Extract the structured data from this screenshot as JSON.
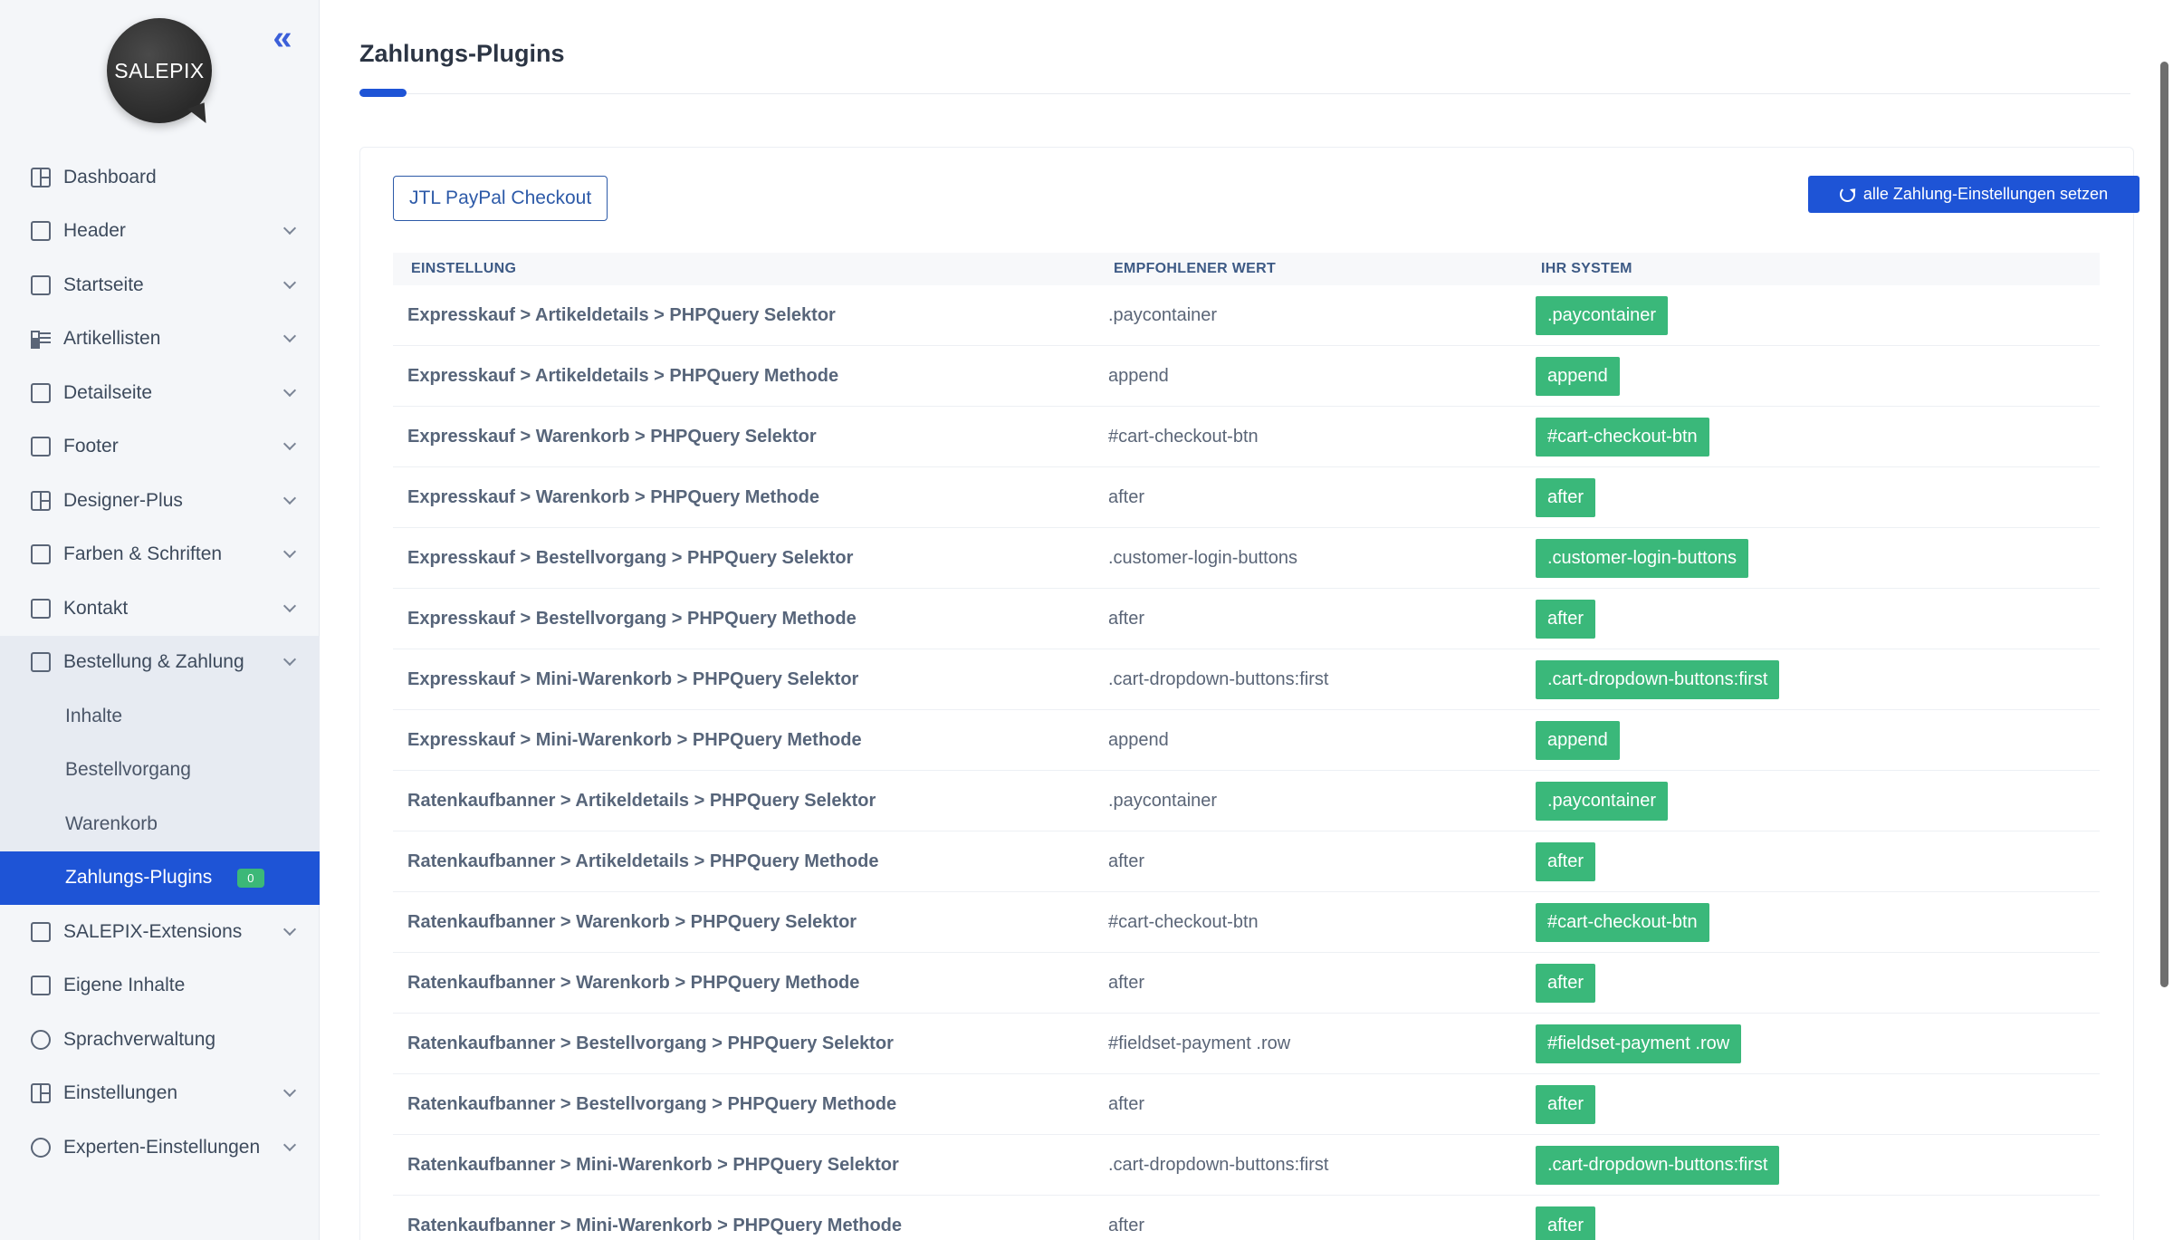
{
  "sidebar": {
    "logo_text": "SALEPIX",
    "collapse_symbol": "«",
    "items": [
      {
        "label": "Dashboard",
        "icon": "dashboard-icon",
        "has_children": false
      },
      {
        "label": "Header",
        "icon": "header-icon",
        "has_children": true
      },
      {
        "label": "Startseite",
        "icon": "home-icon",
        "has_children": true
      },
      {
        "label": "Artikellisten",
        "icon": "list-icon",
        "has_children": true
      },
      {
        "label": "Detailseite",
        "icon": "page-icon",
        "has_children": true
      },
      {
        "label": "Footer",
        "icon": "footer-icon",
        "has_children": true
      },
      {
        "label": "Designer-Plus",
        "icon": "grid-icon",
        "has_children": true
      },
      {
        "label": "Farben & Schriften",
        "icon": "paint-icon",
        "has_children": true
      },
      {
        "label": "Kontakt",
        "icon": "mail-icon",
        "has_children": true
      },
      {
        "label": "Bestellung & Zahlung",
        "icon": "basket-icon",
        "has_children": true,
        "open": true
      }
    ],
    "subitems": [
      {
        "label": "Inhalte"
      },
      {
        "label": "Bestellvorgang"
      },
      {
        "label": "Warenkorb"
      },
      {
        "label": "Zahlungs-Plugins",
        "badge": "0",
        "active": true
      }
    ],
    "items_after": [
      {
        "label": "SALEPIX-Extensions",
        "icon": "box-icon",
        "has_children": true
      },
      {
        "label": "Eigene Inhalte",
        "icon": "toggle-icon",
        "has_children": false
      },
      {
        "label": "Sprachverwaltung",
        "icon": "globe-icon",
        "has_children": false
      },
      {
        "label": "Einstellungen",
        "icon": "settings-grid-icon",
        "has_children": true
      },
      {
        "label": "Experten-Einstellungen",
        "icon": "gear-icon",
        "has_children": true
      }
    ]
  },
  "page": {
    "title": "Zahlungs-Plugins",
    "tab_label": "JTL PayPal Checkout",
    "set_all_label": "alle Zahlung-Einstellungen setzen"
  },
  "table": {
    "headers": [
      "EINSTELLUNG",
      "EMPFOHLENER WERT",
      "IHR SYSTEM"
    ],
    "rows": [
      {
        "setting": "Expresskauf > Artikeldetails > PHPQuery Selektor",
        "recommended": ".paycontainer",
        "system": ".paycontainer"
      },
      {
        "setting": "Expresskauf > Artikeldetails > PHPQuery Methode",
        "recommended": "append",
        "system": "append"
      },
      {
        "setting": "Expresskauf > Warenkorb > PHPQuery Selektor",
        "recommended": "#cart-checkout-btn",
        "system": "#cart-checkout-btn"
      },
      {
        "setting": "Expresskauf > Warenkorb > PHPQuery Methode",
        "recommended": "after",
        "system": "after"
      },
      {
        "setting": "Expresskauf > Bestellvorgang > PHPQuery Selektor",
        "recommended": ".customer-login-buttons",
        "system": ".customer-login-buttons"
      },
      {
        "setting": "Expresskauf > Bestellvorgang > PHPQuery Methode",
        "recommended": "after",
        "system": "after"
      },
      {
        "setting": "Expresskauf > Mini-Warenkorb > PHPQuery Selektor",
        "recommended": ".cart-dropdown-buttons:first",
        "system": ".cart-dropdown-buttons:first"
      },
      {
        "setting": "Expresskauf > Mini-Warenkorb > PHPQuery Methode",
        "recommended": "append",
        "system": "append"
      },
      {
        "setting": "Ratenkaufbanner > Artikeldetails > PHPQuery Selektor",
        "recommended": ".paycontainer",
        "system": ".paycontainer"
      },
      {
        "setting": "Ratenkaufbanner > Artikeldetails > PHPQuery Methode",
        "recommended": "after",
        "system": "after"
      },
      {
        "setting": "Ratenkaufbanner > Warenkorb > PHPQuery Selektor",
        "recommended": "#cart-checkout-btn",
        "system": "#cart-checkout-btn"
      },
      {
        "setting": "Ratenkaufbanner > Warenkorb > PHPQuery Methode",
        "recommended": "after",
        "system": "after"
      },
      {
        "setting": "Ratenkaufbanner > Bestellvorgang > PHPQuery Selektor",
        "recommended": "#fieldset-payment .row",
        "system": "#fieldset-payment .row"
      },
      {
        "setting": "Ratenkaufbanner > Bestellvorgang > PHPQuery Methode",
        "recommended": "after",
        "system": "after"
      },
      {
        "setting": "Ratenkaufbanner > Mini-Warenkorb > PHPQuery Selektor",
        "recommended": ".cart-dropdown-buttons:first",
        "system": ".cart-dropdown-buttons:first"
      },
      {
        "setting": "Ratenkaufbanner > Mini-Warenkorb > PHPQuery Methode",
        "recommended": "after",
        "system": "after"
      }
    ]
  },
  "colors": {
    "accent": "#1e54d6",
    "success": "#3ab87a",
    "sidebar_bg": "#f4f6f9"
  }
}
